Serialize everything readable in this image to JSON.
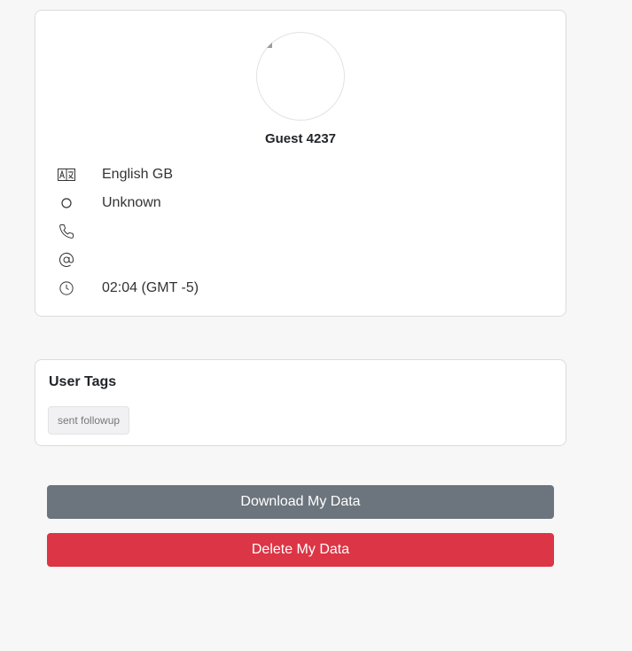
{
  "profile": {
    "name": "Guest 4237",
    "rows": [
      {
        "icon": "language-icon",
        "text": "English GB"
      },
      {
        "icon": "status-circle-icon",
        "text": "Unknown"
      },
      {
        "icon": "phone-icon",
        "text": ""
      },
      {
        "icon": "at-sign-icon",
        "text": ""
      },
      {
        "icon": "clock-icon",
        "text": "02:04 (GMT -5)"
      }
    ]
  },
  "tags": {
    "title": "User Tags",
    "items": [
      "sent followup"
    ]
  },
  "actions": {
    "download_label": "Download My Data",
    "delete_label": "Delete My Data"
  },
  "colors": {
    "download": "#6c757d",
    "delete": "#dc3545",
    "background": "#f7f7f7"
  }
}
